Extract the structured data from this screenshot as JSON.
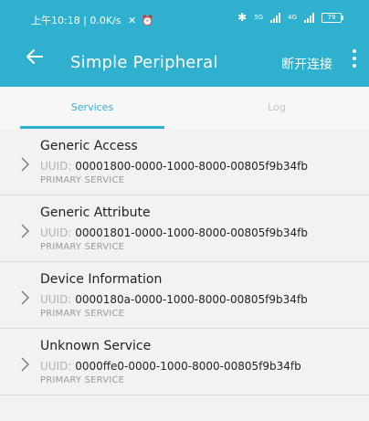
{
  "statusbar": {
    "time_text": "上午10:18 | 0.0K/s",
    "network_label": "5G",
    "network_label_2": "4G",
    "battery_text": "79"
  },
  "toolbar": {
    "title": "Simple Peripheral",
    "action_label": "断开连接"
  },
  "tabs": [
    {
      "label": "Services",
      "active": true
    },
    {
      "label": "Log",
      "active": false
    }
  ],
  "services": [
    {
      "name": "Generic Access",
      "uuid_label": "UUID:",
      "uuid": "00001800-0000-1000-8000-00805f9b34fb",
      "type": "PRIMARY SERVICE"
    },
    {
      "name": "Generic Attribute",
      "uuid_label": "UUID:",
      "uuid": "00001801-0000-1000-8000-00805f9b34fb",
      "type": "PRIMARY SERVICE"
    },
    {
      "name": "Device Information",
      "uuid_label": "UUID:",
      "uuid": "0000180a-0000-1000-8000-00805f9b34fb",
      "type": "PRIMARY SERVICE"
    },
    {
      "name": "Unknown Service",
      "uuid_label": "UUID:",
      "uuid": "0000ffe0-0000-1000-8000-00805f9b34fb",
      "type": "PRIMARY SERVICE"
    }
  ],
  "colors": {
    "accent": "#2fb0cf",
    "background": "#f2f2f2"
  },
  "icons": {
    "back": "arrow-left-icon",
    "more": "more-vert-icon",
    "expand": "chevron-right-icon",
    "alarm": "alarm-icon",
    "bluetooth": "bluetooth-icon"
  }
}
